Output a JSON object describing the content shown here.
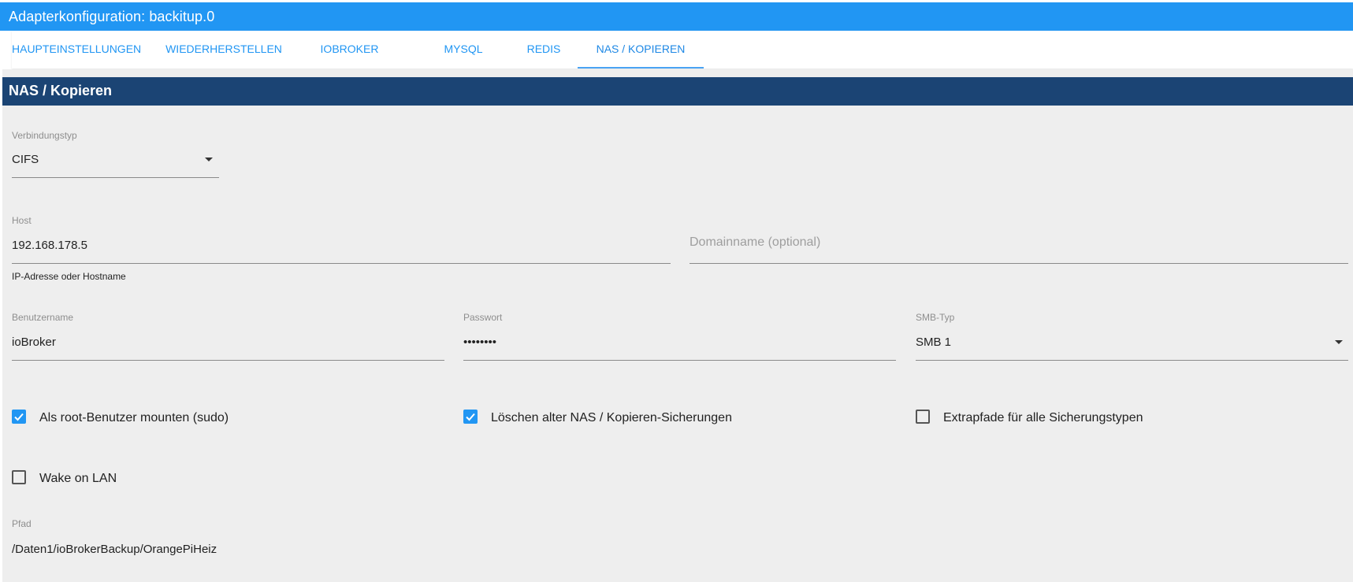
{
  "window": {
    "title": "Adapterkonfiguration: backitup.0"
  },
  "tabs": [
    {
      "label": "HAUPTEINSTELLUNGEN",
      "active": false
    },
    {
      "label": "WIEDERHERSTELLEN",
      "active": false
    },
    {
      "label": "IOBROKER",
      "active": false
    },
    {
      "label": "MYSQL",
      "active": false
    },
    {
      "label": "REDIS",
      "active": false
    },
    {
      "label": "NAS / KOPIEREN",
      "active": true
    }
  ],
  "section": {
    "title": "NAS / Kopieren"
  },
  "fields": {
    "connection_type": {
      "label": "Verbindungstyp",
      "value": "CIFS"
    },
    "host": {
      "label": "Host",
      "value": "192.168.178.5",
      "helper": "IP-Adresse oder Hostname"
    },
    "domain": {
      "placeholder": "Domainname (optional)"
    },
    "username": {
      "label": "Benutzername",
      "value": "ioBroker"
    },
    "password": {
      "label": "Passwort",
      "value": "••••••••"
    },
    "smb_type": {
      "label": "SMB-Typ",
      "value": "SMB 1"
    },
    "path": {
      "label": "Pfad",
      "value": "/Daten1/ioBrokerBackup/OrangePiHeiz"
    }
  },
  "checkboxes": {
    "sudo": {
      "label": "Als root-Benutzer mounten (sudo)",
      "checked": true
    },
    "delete_old": {
      "label": "Löschen alter NAS / Kopieren-Sicherungen",
      "checked": true
    },
    "extra_paths": {
      "label": "Extrapfade für alle Sicherungstypen",
      "checked": false
    },
    "wol": {
      "label": "Wake on LAN",
      "checked": false
    }
  },
  "colors": {
    "accent": "#2196f3",
    "section_header": "#1b4474",
    "panel_bg": "#eeeeee"
  },
  "icons": {
    "dropdown": "caret-down-icon",
    "check": "check-icon"
  }
}
